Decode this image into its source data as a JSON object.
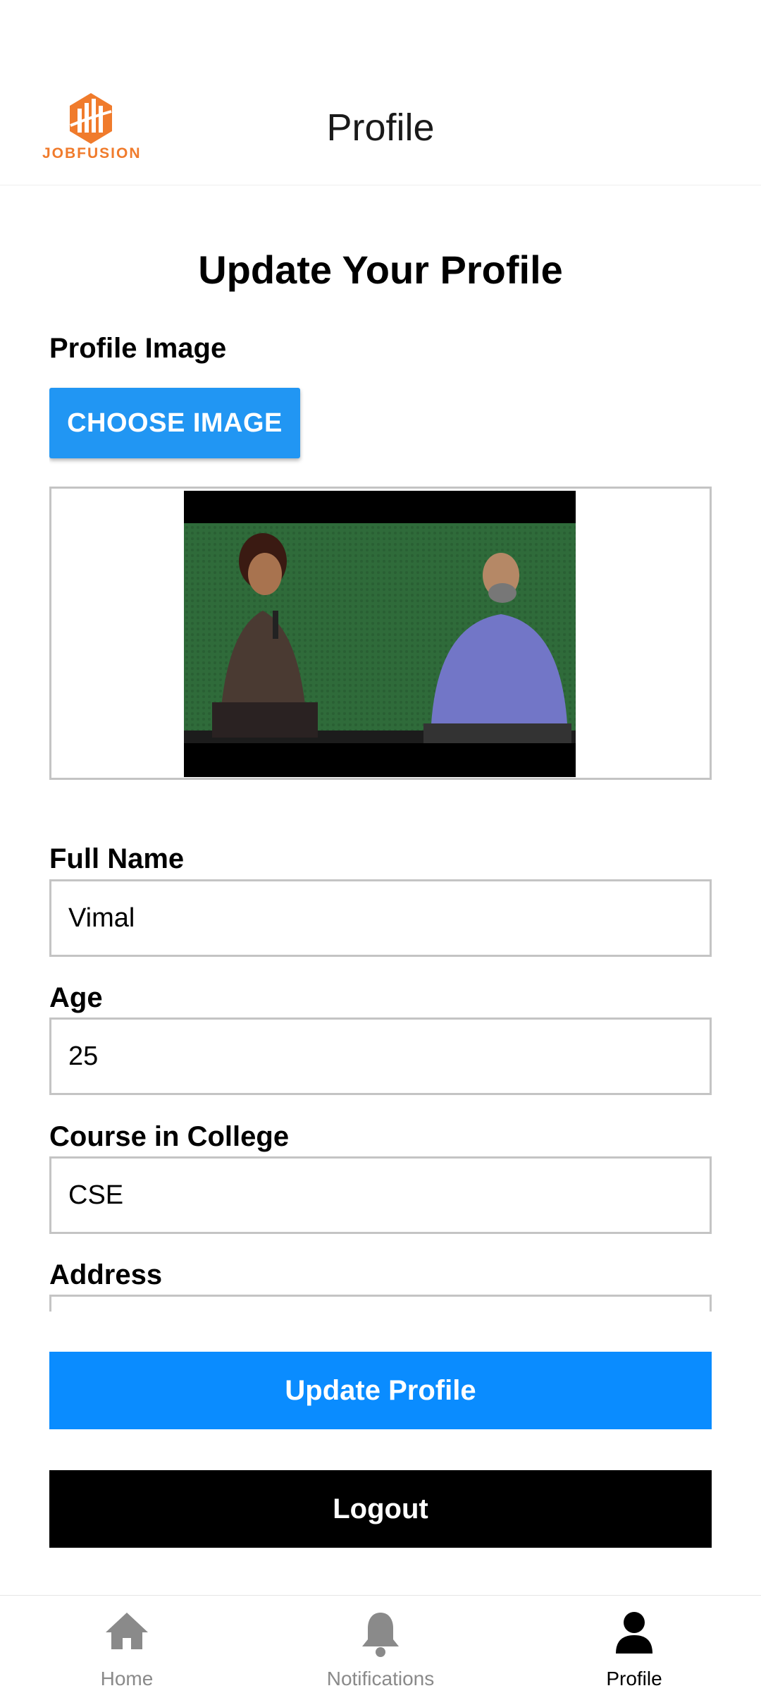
{
  "header": {
    "logo_text": "JOBFUSION",
    "title": "Profile"
  },
  "form": {
    "title": "Update Your Profile",
    "profile_image_label": "Profile Image",
    "choose_image_label": "CHOOSE IMAGE",
    "full_name": {
      "label": "Full Name",
      "value": "Vimal"
    },
    "age": {
      "label": "Age",
      "value": "25"
    },
    "course": {
      "label": "Course in College",
      "value": "CSE"
    },
    "address": {
      "label": "Address",
      "value": ""
    }
  },
  "actions": {
    "update_label": "Update Profile",
    "logout_label": "Logout"
  },
  "tabbar": {
    "items": [
      {
        "label": "Home",
        "icon": "home-icon",
        "active": false
      },
      {
        "label": "Notifications",
        "icon": "bell-icon",
        "active": false
      },
      {
        "label": "Profile",
        "icon": "person-icon",
        "active": true
      }
    ]
  },
  "colors": {
    "accent_blue": "#0a8cff",
    "choose_button": "#2196f3",
    "logo_orange": "#f07b2c",
    "input_border": "#c4c4c4"
  }
}
